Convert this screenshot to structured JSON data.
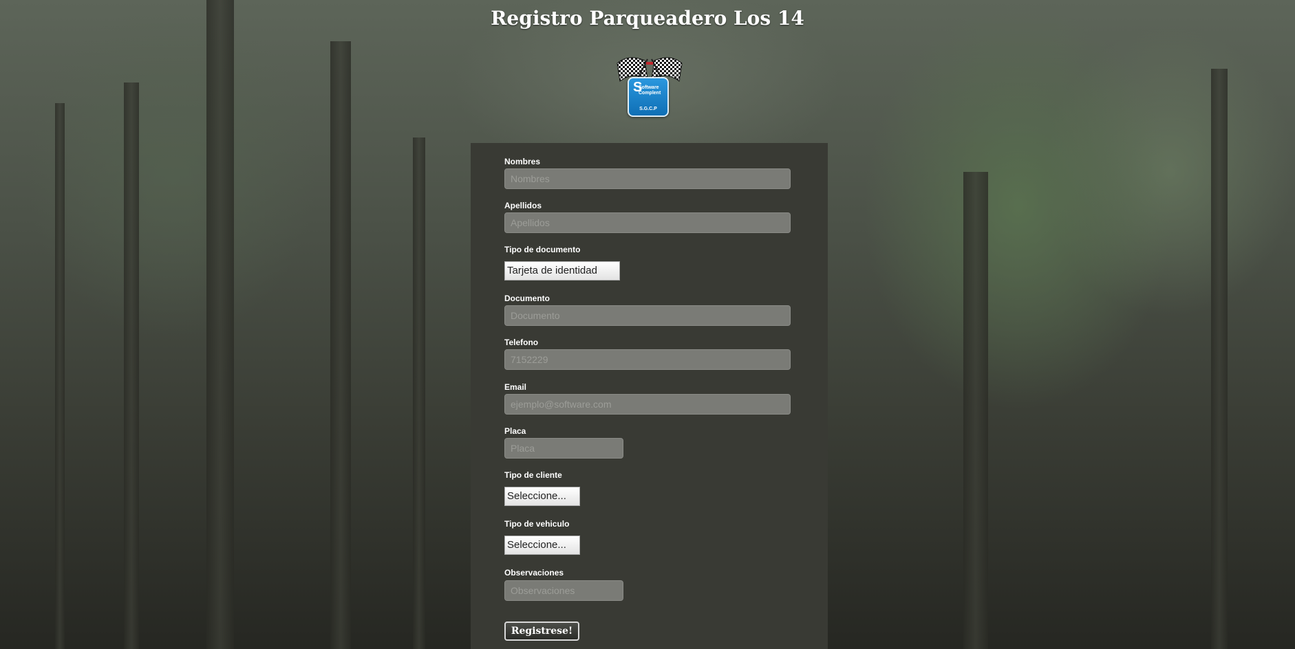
{
  "page": {
    "title": "Registro Parqueadero Los 14"
  },
  "logo": {
    "brand_line1": "Software",
    "brand_line2": "Complent",
    "initial": "S",
    "acronym": "S.G.C.P",
    "flag_icon": "checkered-flags-icon"
  },
  "form": {
    "nombres": {
      "label": "Nombres",
      "placeholder": "Nombres"
    },
    "apellidos": {
      "label": "Apellidos",
      "placeholder": "Apellidos"
    },
    "tipo_documento": {
      "label": "Tipo de documento",
      "selected": "Tarjeta de identidad"
    },
    "documento": {
      "label": "Documento",
      "placeholder": "Documento"
    },
    "telefono": {
      "label": "Telefono",
      "placeholder": "7152229"
    },
    "email": {
      "label": "Email",
      "placeholder": "ejemplo@software.com"
    },
    "placa": {
      "label": "Placa",
      "placeholder": "Placa"
    },
    "tipo_cliente": {
      "label": "Tipo de cliente",
      "selected": "Seleccione..."
    },
    "tipo_vehiculo": {
      "label": "Tipo de vehiculo",
      "selected": "Seleccione..."
    },
    "observaciones": {
      "label": "Observaciones",
      "placeholder": "Observaciones"
    },
    "submit_label": "Registrese!"
  },
  "colors": {
    "panel": "#393a34",
    "input_bg": "#7a7b76",
    "logo_blue": "#1a82c8"
  }
}
